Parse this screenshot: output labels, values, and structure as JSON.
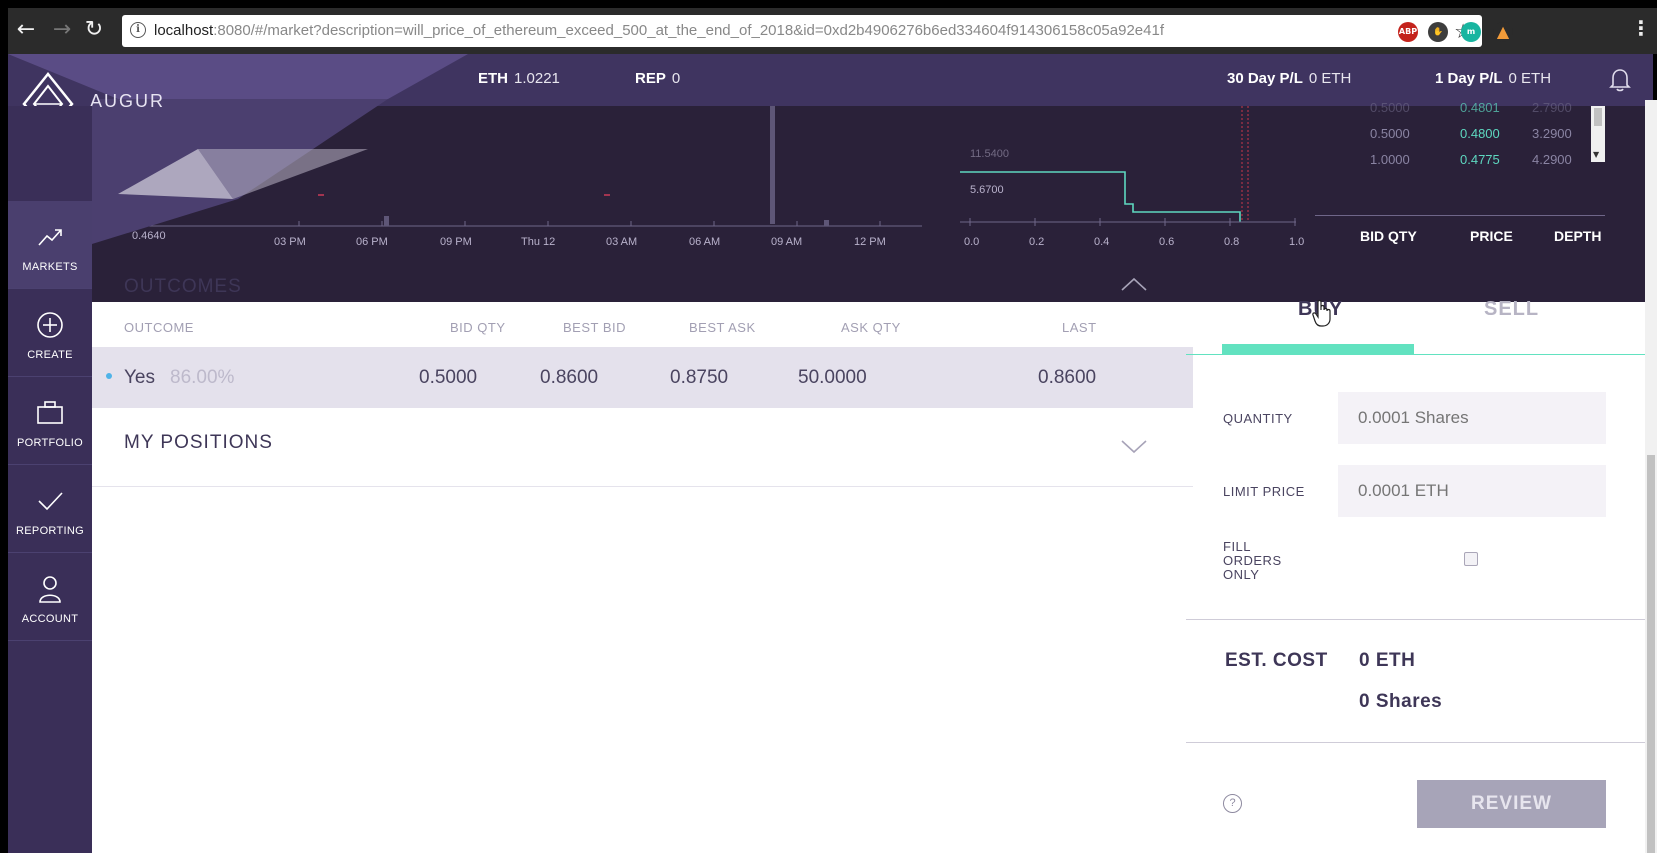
{
  "browser": {
    "url_host": "localhost",
    "url_rest": ":8080/#/market?description=will_price_of_ethereum_exceed_500_at_the_end_of_2018&id=0xd2b4906276b6ed334604f914306158c05a92e41f",
    "extensions": [
      "ABP",
      "m"
    ]
  },
  "topbar": {
    "logo": "AUGUR",
    "eth_label": "ETH",
    "eth_value": "1.0221",
    "rep_label": "REP",
    "rep_value": "0",
    "pl30_label": "30 Day P/L",
    "pl30_value": "0 ETH",
    "pl1_label": "1 Day P/L",
    "pl1_value": "0 ETH"
  },
  "sidebar": {
    "items": [
      {
        "label": "MARKETS",
        "icon": "trend-icon"
      },
      {
        "label": "CREATE",
        "icon": "plus-circle-icon"
      },
      {
        "label": "PORTFOLIO",
        "icon": "briefcase-icon"
      },
      {
        "label": "REPORTING",
        "icon": "check-icon"
      },
      {
        "label": "ACCOUNT",
        "icon": "user-icon"
      }
    ]
  },
  "price_history": {
    "y_label": "0.4640",
    "x_ticks": [
      "03 PM",
      "06 PM",
      "09 PM",
      "Thu 12",
      "03 AM",
      "06 AM",
      "09 AM",
      "12 PM"
    ]
  },
  "depth_chart": {
    "y_labels": [
      "11.5400",
      "5.6700"
    ],
    "x_ticks": [
      "0.0",
      "0.2",
      "0.4",
      "0.6",
      "0.8",
      "1.0"
    ]
  },
  "order_book": {
    "rows": [
      {
        "qty": "0.5000",
        "price": "0.4801",
        "depth": "2.7900"
      },
      {
        "qty": "0.5000",
        "price": "0.4800",
        "depth": "3.2900"
      },
      {
        "qty": "1.0000",
        "price": "0.4775",
        "depth": "4.2900"
      }
    ],
    "headers": {
      "qty": "BID QTY",
      "price": "PRICE",
      "depth": "DEPTH"
    }
  },
  "outcomes": {
    "title": "OUTCOMES",
    "headers": {
      "outcome": "OUTCOME",
      "bid_qty": "BID QTY",
      "best_bid": "BEST BID",
      "best_ask": "BEST ASK",
      "ask_qty": "ASK QTY",
      "last": "LAST"
    },
    "row": {
      "name": "Yes",
      "pct": "86.00%",
      "bid_qty": "0.5000",
      "best_bid": "0.8600",
      "best_ask": "0.8750",
      "ask_qty": "50.0000",
      "last": "0.8600"
    }
  },
  "positions": {
    "title": "MY POSITIONS"
  },
  "trade": {
    "buy_label": "BUY",
    "sell_label": "SELL",
    "quantity_label": "QUANTITY",
    "quantity_placeholder": "0.0001 Shares",
    "limit_label": "LIMIT PRICE",
    "limit_placeholder": "0.0001 ETH",
    "fill_label_1": "FILL",
    "fill_label_2": "ORDERS",
    "fill_label_3": "ONLY",
    "est_cost_label": "EST. COST",
    "est_cost_eth": "0 ETH",
    "est_cost_shares": "0 Shares",
    "help_glyph": "?",
    "review_label": "REVIEW"
  },
  "colors": {
    "accent": "#62e2c0",
    "brand": "#3f3460",
    "sidebar": "#3a2f58"
  }
}
